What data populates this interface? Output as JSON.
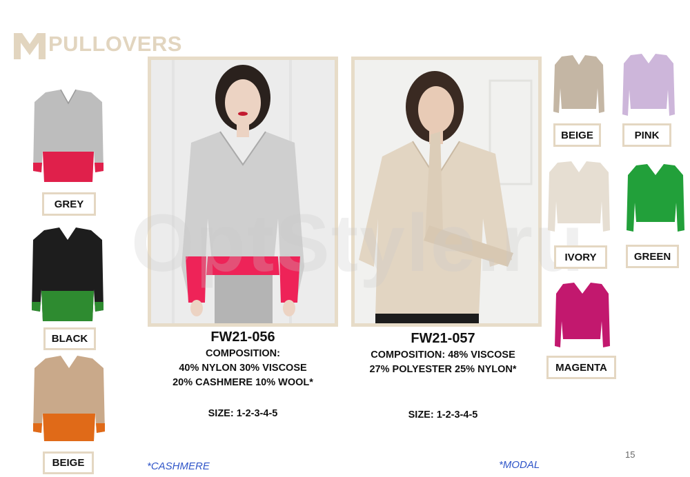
{
  "header": {
    "title": "PULLOVERS",
    "logo_icon": "m-logo-icon"
  },
  "left_swatches": [
    {
      "label": "GREY",
      "top": "#bdbdbd",
      "bottom": "#e0204b"
    },
    {
      "label": "BLACK",
      "top": "#1d1d1d",
      "bottom": "#2e8b30"
    },
    {
      "label": "BEIGE",
      "top": "#c9a98a",
      "bottom": "#e06a18"
    }
  ],
  "products": [
    {
      "code": "FW21-056",
      "composition": [
        "COMPOSITION:",
        "40% NYLON 30% VISCOSE",
        "20% CASHMERE 10% WOOL*"
      ],
      "size": "SIZE: 1-2-3-4-5",
      "note": "*CASHMERE"
    },
    {
      "code": "FW21-057",
      "composition": [
        "COMPOSITION: 48% VISCOSE",
        "27% POLYESTER 25% NYLON*"
      ],
      "size": "SIZE: 1-2-3-4-5",
      "note": "*MODAL"
    }
  ],
  "right_swatches": [
    {
      "label": "BEIGE",
      "color": "#c4b6a4"
    },
    {
      "label": "PINK",
      "color": "#cdb6da"
    },
    {
      "label": "IVORY",
      "color": "#e6ded2"
    },
    {
      "label": "GREEN",
      "color": "#22a03a"
    },
    {
      "label": "MAGENTA",
      "color": "#c2186e"
    }
  ],
  "watermark": "OptStyle.ru",
  "page_number": "15",
  "colors": {
    "frame": "#e7dcc8",
    "note_blue": "#2f55c8"
  }
}
